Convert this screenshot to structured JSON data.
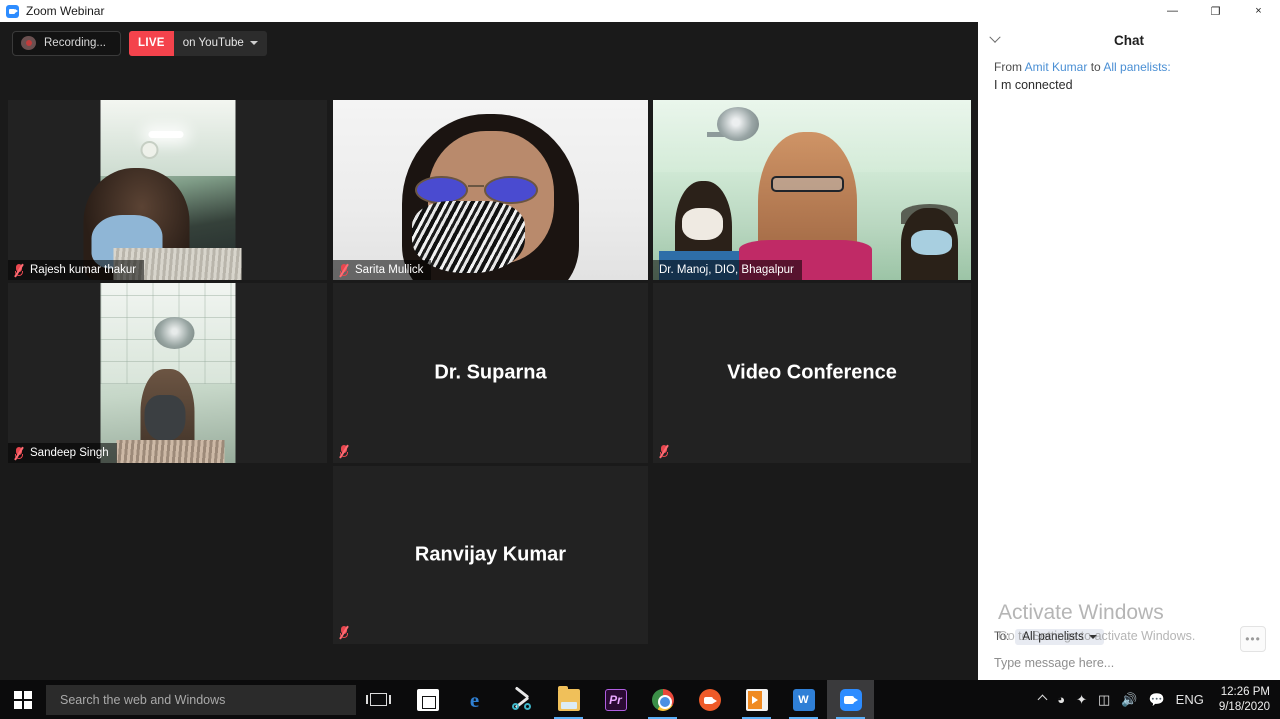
{
  "window": {
    "title": "Zoom Webinar",
    "app_icon": "zoom-camera-icon",
    "minimize": "—",
    "restore": "❐",
    "close": "×"
  },
  "toolbar": {
    "recording_label": "Recording...",
    "live_badge": "LIVE",
    "live_platform": "on YouTube"
  },
  "grid": {
    "tiles": [
      {
        "name": "Rajesh kumar thakur",
        "muted": true,
        "has_video": true,
        "active_speaker": false,
        "placeholder": ""
      },
      {
        "name": "Sarita Mullick",
        "muted": true,
        "has_video": true,
        "active_speaker": false,
        "placeholder": ""
      },
      {
        "name": "Dr. Manoj, DIO, Bhagalpur",
        "muted": false,
        "has_video": true,
        "active_speaker": true,
        "placeholder": ""
      },
      {
        "name": "Sandeep Singh",
        "muted": true,
        "has_video": true,
        "active_speaker": false,
        "placeholder": ""
      },
      {
        "name": "Dr. Suparna",
        "muted": true,
        "has_video": false,
        "active_speaker": false,
        "placeholder": "Dr. Suparna"
      },
      {
        "name": "Video Conference",
        "muted": true,
        "has_video": false,
        "active_speaker": false,
        "placeholder": "Video Conference"
      },
      {
        "name": "Ranvijay Kumar",
        "muted": true,
        "has_video": false,
        "active_speaker": false,
        "placeholder": "Ranvijay Kumar"
      }
    ],
    "active_border_color": "#d6f04a"
  },
  "chat": {
    "title": "Chat",
    "collapse_icon": "chevron-down-icon",
    "messages": [
      {
        "prefix": "From ",
        "sender": "Amit Kumar",
        "mid": " to ",
        "recipient": "All panelists:",
        "text": "I m connected"
      }
    ],
    "to_label": "To:",
    "to_value": "All panelists",
    "more_label": "•••",
    "input_placeholder": "Type message here..."
  },
  "watermark": {
    "title": "Activate Windows",
    "subtitle": "Go to Settings to activate Windows."
  },
  "taskbar": {
    "start_icon": "windows-logo-icon",
    "search_placeholder": "Search the web and Windows",
    "task_view_icon": "task-view-icon",
    "apps": [
      {
        "name": "microsoft-store",
        "label": "Store",
        "open": false,
        "active": false
      },
      {
        "name": "microsoft-edge",
        "label": "e",
        "open": false,
        "active": false
      },
      {
        "name": "snipping-tool",
        "label": "Snip",
        "open": false,
        "active": false
      },
      {
        "name": "file-explorer",
        "label": "Explorer",
        "open": true,
        "active": false
      },
      {
        "name": "premiere-pro",
        "label": "Pr",
        "open": false,
        "active": false
      },
      {
        "name": "google-chrome",
        "label": "Chrome",
        "open": true,
        "active": false
      },
      {
        "name": "zoom-orange",
        "label": "Zoom",
        "open": false,
        "active": false
      },
      {
        "name": "media-player",
        "label": "Media",
        "open": true,
        "active": false
      },
      {
        "name": "wps-office",
        "label": "W",
        "open": true,
        "active": false
      },
      {
        "name": "zoom-meeting",
        "label": "Zoom",
        "open": true,
        "active": true
      }
    ],
    "tray": {
      "chevron": "show-hidden-icons",
      "wifi": "wifi-icon",
      "dropbox": "dropbox-icon",
      "battery": "battery-icon",
      "volume": "volume-icon",
      "action_center": "action-center-icon",
      "language": "ENG",
      "time": "12:26 PM",
      "date": "9/18/2020"
    }
  }
}
